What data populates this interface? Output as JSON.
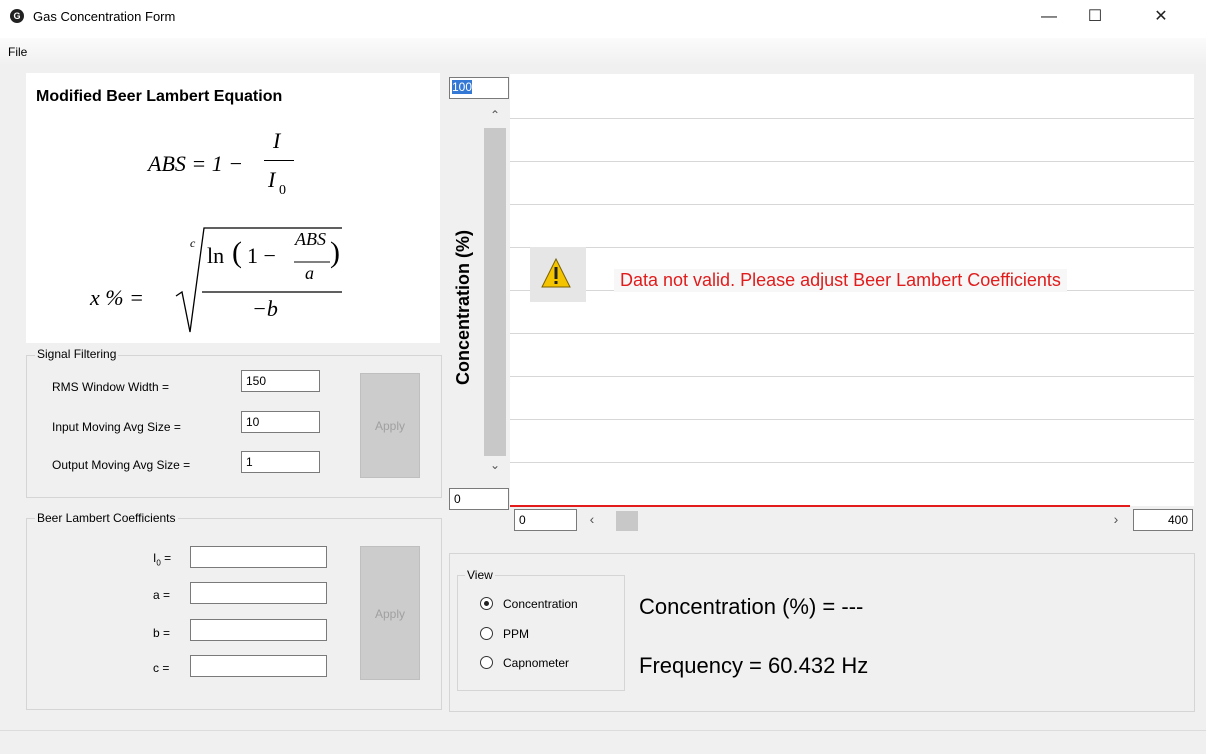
{
  "window": {
    "title": "Gas Concentration Form",
    "icon": "app-logo-icon",
    "minimize_glyph": "—",
    "maximize_glyph": "☐",
    "close_glyph": "✕"
  },
  "menu": {
    "file": "File"
  },
  "equation": {
    "title": "Modified Beer Lambert Equation",
    "abs_lhs": "ABS = 1 −",
    "abs_num": "I",
    "abs_den": "I",
    "abs_den_sub": "0",
    "x_lhs": "x % =",
    "root_index": "c",
    "ln_text": "ln",
    "inner_prefix": "1 −",
    "inner_num": "ABS",
    "inner_den": "a",
    "outer_den": "−b"
  },
  "signal_filtering": {
    "label": "Signal Filtering",
    "rms_label": "RMS Window Width =",
    "rms_value": "150",
    "input_label": "Input Moving Avg Size =",
    "input_value": "10",
    "output_label": "Output Moving Avg Size =",
    "output_value": "1",
    "apply": "Apply"
  },
  "beer_lambert": {
    "label": "Beer Lambert Coefficients",
    "i0_label": "I",
    "i0_sub": "0",
    "i0_eq": "=",
    "a_label": "a =",
    "b_label": "b =",
    "c_label": "c =",
    "i0_value": "",
    "a_value": "",
    "b_value": "",
    "c_value": "",
    "apply": "Apply"
  },
  "chart": {
    "y_max": "100",
    "y_min": "0",
    "x_min": "0",
    "x_max": "400",
    "y_axis_label": "Concentration (%)",
    "warning": "Data not valid. Please adjust Beer Lambert Coefficients",
    "warning_icon": "warning-icon",
    "line_color": "#e31b1b"
  },
  "view": {
    "label": "View",
    "options": [
      "Concentration",
      "PPM",
      "Capnometer"
    ],
    "selected": "Concentration",
    "concentration_readout": "Concentration (%) = ---",
    "frequency_readout": "Frequency = 60.432 Hz"
  }
}
